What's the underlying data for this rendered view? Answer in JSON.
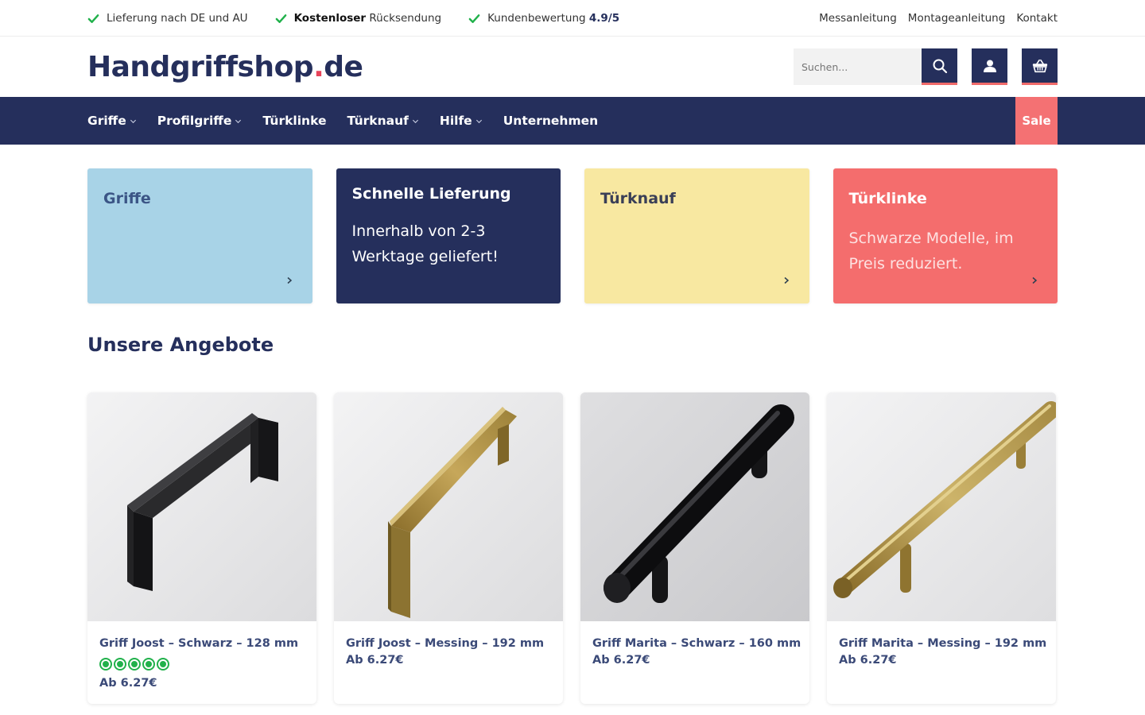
{
  "topbar": {
    "usps": [
      {
        "pre": "",
        "bold": "",
        "text": "Lieferung nach DE und AU",
        "rating": ""
      },
      {
        "pre": "",
        "bold": "Kostenloser",
        "text": " Rücksendung",
        "rating": ""
      },
      {
        "pre": "",
        "bold": "",
        "text": "Kundenbewertung ",
        "rating": "4.9/5"
      }
    ],
    "links": [
      "Messanleitung",
      "Montageanleitung",
      "Kontakt"
    ]
  },
  "header": {
    "logo_main": "Handgriffshop",
    "logo_dot": ".",
    "logo_tld": "de",
    "search_placeholder": "Suchen...",
    "icons": [
      "search-icon",
      "user-icon",
      "basket-icon"
    ]
  },
  "nav": {
    "items": [
      {
        "label": "Griffe",
        "dropdown": true
      },
      {
        "label": "Profilgriffe",
        "dropdown": true
      },
      {
        "label": "Türklinke",
        "dropdown": false
      },
      {
        "label": "Türknauf",
        "dropdown": true
      },
      {
        "label": "Hilfe",
        "dropdown": true
      },
      {
        "label": "Unternehmen",
        "dropdown": false
      }
    ],
    "sale": "Sale"
  },
  "tiles": [
    {
      "title": "Griffe",
      "text": "",
      "color": "#a8d3e7"
    },
    {
      "title": "Schnelle Lieferung",
      "text": "Innerhalb von 2-3 Werktage geliefert!",
      "color": "#252f5c"
    },
    {
      "title": "Türknauf",
      "text": "",
      "color": "#f8e8a1"
    },
    {
      "title": "Türklinke",
      "text": "Schwarze Modelle, im Preis reduziert.",
      "color": "#f46d6d"
    }
  ],
  "section": {
    "title": "Unsere Angebote"
  },
  "products": [
    {
      "name": "Griff Joost – Schwarz – 128 mm",
      "price": "Ab 6.27€",
      "rating_stars": 5,
      "finish": "black",
      "shape": "square"
    },
    {
      "name": "Griff Joost – Messing – 192 mm",
      "price": "Ab 6.27€",
      "rating_stars": 0,
      "finish": "brass",
      "shape": "square"
    },
    {
      "name": "Griff Marita – Schwarz – 160 mm",
      "price": "Ab 6.27€",
      "rating_stars": 0,
      "finish": "black",
      "shape": "round"
    },
    {
      "name": "Griff Marita – Messing – 192 mm",
      "price": "Ab 6.27€",
      "rating_stars": 0,
      "finish": "brass",
      "shape": "round"
    }
  ],
  "colors": {
    "brand": "#252f5c",
    "accent": "#f06a6a",
    "check": "#21b14b"
  }
}
